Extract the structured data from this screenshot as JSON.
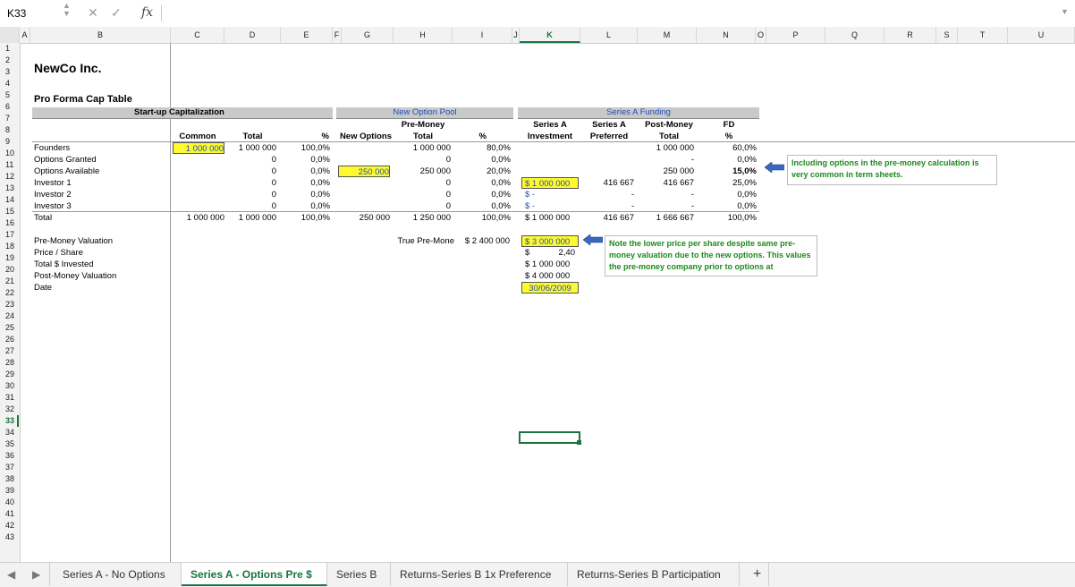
{
  "formula_bar": {
    "name_box": "K33",
    "cancel_icon": "✕",
    "enter_icon": "✓",
    "fx_label": "fx"
  },
  "columns": [
    "A",
    "B",
    "C",
    "D",
    "E",
    "F",
    "G",
    "H",
    "I",
    "J",
    "K",
    "L",
    "M",
    "N",
    "O",
    "P",
    "Q",
    "R",
    "S",
    "T",
    "U"
  ],
  "selected_column": "K",
  "rows": [
    "1",
    "2",
    "3",
    "4",
    "5",
    "6",
    "7",
    "8",
    "9",
    "10",
    "11",
    "12",
    "13",
    "14",
    "15",
    "16",
    "17",
    "18",
    "19",
    "20",
    "21",
    "22",
    "23",
    "24",
    "25",
    "26",
    "27",
    "28",
    "29",
    "30",
    "31",
    "32",
    "33",
    "34",
    "35",
    "36",
    "37",
    "38",
    "39",
    "40",
    "41",
    "42",
    "43"
  ],
  "selected_row": "33",
  "sheet": {
    "company": "NewCo Inc.",
    "subtitle": "Pro Forma Cap Table",
    "startup_header": "Start-up Capitalization",
    "new_option_pool_header": "New Option Pool",
    "series_a_header": "Series A Funding",
    "col_headers": {
      "common": "Common",
      "total": "Total",
      "pct": "%",
      "new_options": "New Options",
      "pre_money": "Pre-Money",
      "pre_total": "Total",
      "pre_pct": "%",
      "series_a1": "Series A",
      "investment": "Investment",
      "series_a2": "Series A",
      "preferred": "Preferred",
      "post_money": "Post-Money",
      "post_total": "Total",
      "fd": "FD",
      "fd_pct": "%"
    },
    "table_rows": [
      {
        "label": "Founders",
        "common": "1 000 000",
        "total": "1 000 000",
        "pct": "100,0%",
        "new_opt": "",
        "pre_total": "1 000 000",
        "pre_pct": "80,0%",
        "inv": "",
        "pref": "",
        "post": "1 000 000",
        "fd": "60,0%"
      },
      {
        "label": "Options Granted",
        "common": "",
        "total": "0",
        "pct": "0,0%",
        "new_opt": "",
        "pre_total": "0",
        "pre_pct": "0,0%",
        "inv": "",
        "pref": "",
        "post": "-",
        "fd": "0,0%"
      },
      {
        "label": "Options Available",
        "common": "",
        "total": "0",
        "pct": "0,0%",
        "new_opt": "250 000",
        "pre_total": "250 000",
        "pre_pct": "20,0%",
        "inv": "",
        "pref": "",
        "post": "250 000",
        "fd": "15,0%"
      },
      {
        "label": "Investor 1",
        "common": "",
        "total": "0",
        "pct": "0,0%",
        "new_opt": "",
        "pre_total": "0",
        "pre_pct": "0,0%",
        "inv": "$  1 000 000",
        "pref": "416 667",
        "post": "416 667",
        "fd": "25,0%"
      },
      {
        "label": "Investor 2",
        "common": "",
        "total": "0",
        "pct": "0,0%",
        "new_opt": "",
        "pre_total": "0",
        "pre_pct": "0,0%",
        "inv": "$           -",
        "pref": "-",
        "post": "-",
        "fd": "0,0%"
      },
      {
        "label": "Investor 3",
        "common": "",
        "total": "0",
        "pct": "0,0%",
        "new_opt": "",
        "pre_total": "0",
        "pre_pct": "0,0%",
        "inv": "$           -",
        "pref": "-",
        "post": "-",
        "fd": "0,0%"
      },
      {
        "label": "Total",
        "common": "1 000 000",
        "total": "1 000 000",
        "pct": "100,0%",
        "new_opt": "250 000",
        "pre_total": "1 250 000",
        "pre_pct": "100,0%",
        "inv": "$  1 000 000",
        "pref": "416 667",
        "post": "1 666 667",
        "fd": "100,0%"
      }
    ],
    "valuation_labels": [
      "Pre-Money Valuation",
      "Price / Share",
      "Total $ Invested",
      "Post-Money Valuation",
      "Date"
    ],
    "true_pre_money_label": "True Pre-Mone",
    "true_pre_money_value": "$  2 400 000",
    "valuation_values": [
      "$  3 000 000",
      "2,40",
      "$  1 000 000",
      "$  4 000 000",
      "30/06/2009"
    ],
    "dollar_sign": "$",
    "note1": "Including options in the pre-money calculation is very common in term sheets.",
    "note2": "Note the lower price per share despite same pre-money valuation due to the new options.  This values the pre-money company prior to options at"
  },
  "tabs": [
    "Series A - No Options",
    "Series A - Options Pre $",
    "Series B",
    "Returns-Series B 1x Preference",
    "Returns-Series B Participation"
  ],
  "active_tab": "Series A - Options Pre $",
  "add_sheet_label": "+",
  "colors": {
    "accent_green": "#1a7340",
    "highlight_yellow": "#fffa2e",
    "blue_header": "#1f4eb4",
    "note_green": "#1c8a1c"
  }
}
